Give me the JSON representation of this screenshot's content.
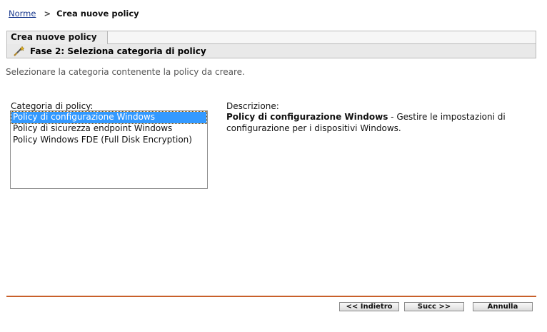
{
  "breadcrumb": {
    "root_link": "Norme",
    "separator": ">",
    "current": "Crea nuove policy"
  },
  "wizard": {
    "tab_label": "Crea nuove policy",
    "step_label": "Fase 2: Seleziona categoria di policy",
    "step_icon": "wand-icon"
  },
  "instructions": "Selezionare la categoria contenente la policy da creare.",
  "category": {
    "label": "Categoria di policy:",
    "options": [
      "Policy di configurazione Windows",
      "Policy di sicurezza endpoint Windows",
      "Policy Windows FDE (Full Disk Encryption)"
    ],
    "selected_index": 0
  },
  "description": {
    "label": "Descrizione:",
    "title": "Policy di configurazione Windows",
    "text": " - Gestire le impostazioni di configurazione per i dispositivi Windows."
  },
  "buttons": {
    "back": "<< Indietro",
    "next": "Succ >>",
    "cancel": "Annulla"
  },
  "colors": {
    "accent_rule": "#c8602a",
    "link": "#1a3a8f",
    "selection": "#3399ff"
  }
}
